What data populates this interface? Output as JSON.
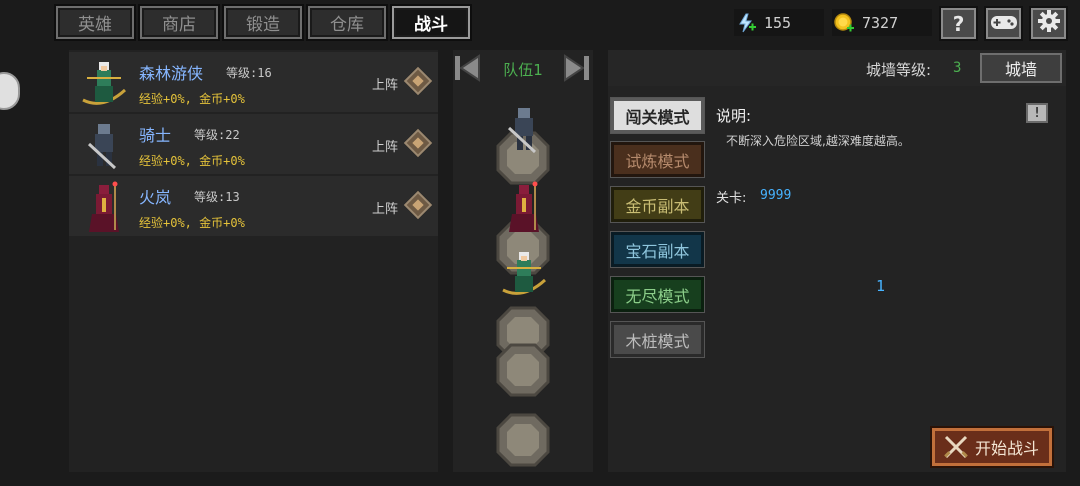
{
  "tabs": [
    {
      "label": "英雄"
    },
    {
      "label": "商店"
    },
    {
      "label": "锻造"
    },
    {
      "label": "仓库"
    },
    {
      "label": "战斗"
    }
  ],
  "resources": {
    "energy": {
      "value": "155",
      "icon": "lightning-plus-icon"
    },
    "gold": {
      "value": "7327",
      "icon": "coin-plus-icon"
    }
  },
  "top_buttons": {
    "help": "?",
    "gamepad_icon": "gamepad-icon",
    "settings_icon": "gear-icon"
  },
  "heroes": [
    {
      "name": "森林游侠",
      "level": "等级:16",
      "bonus": "经验+0%, 金币+0%",
      "deploy": "上阵"
    },
    {
      "name": "骑士",
      "level": "等级:22",
      "bonus": "经验+0%, 金币+0%",
      "deploy": "上阵"
    },
    {
      "name": "火岚",
      "level": "等级:13",
      "bonus": "经验+0%, 金币+0%",
      "deploy": "上阵"
    }
  ],
  "team": {
    "title": "队伍1"
  },
  "wall": {
    "label": "城墙等级:",
    "level": "3",
    "button": "城墙"
  },
  "modes": [
    {
      "label": "闯关模式"
    },
    {
      "label": "试炼模式"
    },
    {
      "label": "金币副本"
    },
    {
      "label": "宝石副本"
    },
    {
      "label": "无尽模式"
    },
    {
      "label": "木桩模式"
    }
  ],
  "description": {
    "title": "说明:",
    "text": "不断深入危险区域,越深难度越高。",
    "stage_label": "关卡:",
    "stage_value": "9999",
    "center_number": "1",
    "info_button": "!"
  },
  "start_button": {
    "label": "开始战斗",
    "icon": "crossed-swords-icon"
  },
  "colors": {
    "accent_green": "#4caf50",
    "accent_blue": "#47b3ff",
    "name_blue": "#86b6ff",
    "bonus_yellow": "#e4c23a"
  }
}
